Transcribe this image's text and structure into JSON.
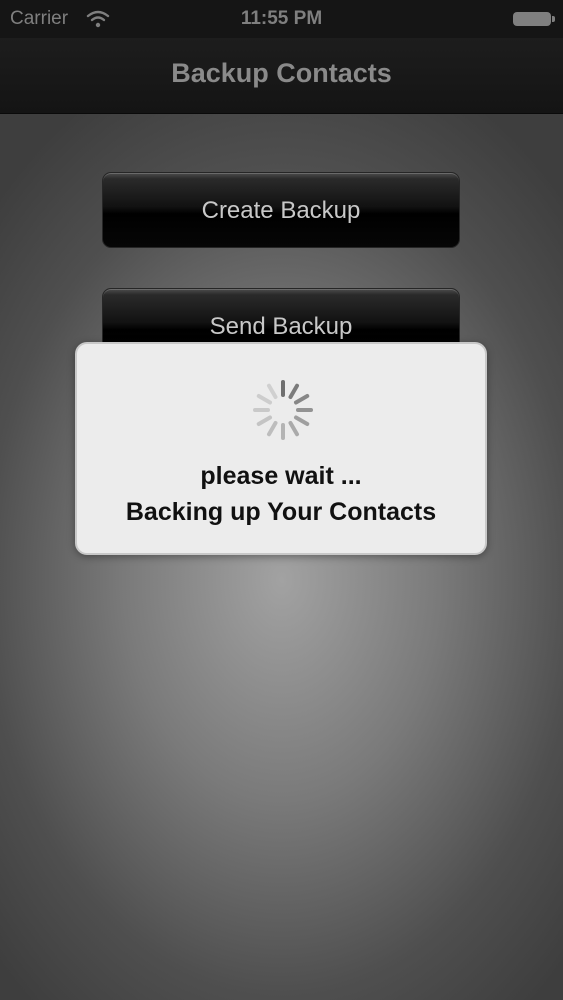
{
  "status_bar": {
    "carrier": "Carrier",
    "time": "11:55 PM",
    "wifi_icon": "wifi-icon",
    "battery_icon": "battery-icon"
  },
  "nav": {
    "title": "Backup Contacts"
  },
  "buttons": {
    "create_backup": "Create Backup",
    "send_backup": "Send Backup"
  },
  "hud": {
    "spinner_icon": "activity-spinner-icon",
    "line1": "please wait ...",
    "line2": "Backing up Your Contacts"
  },
  "colors": {
    "nav_background": "#151515",
    "nav_text": "#8a8a8a",
    "button_text": "#c8c8c8",
    "hud_background": "#ececec",
    "hud_text": "#111111"
  }
}
